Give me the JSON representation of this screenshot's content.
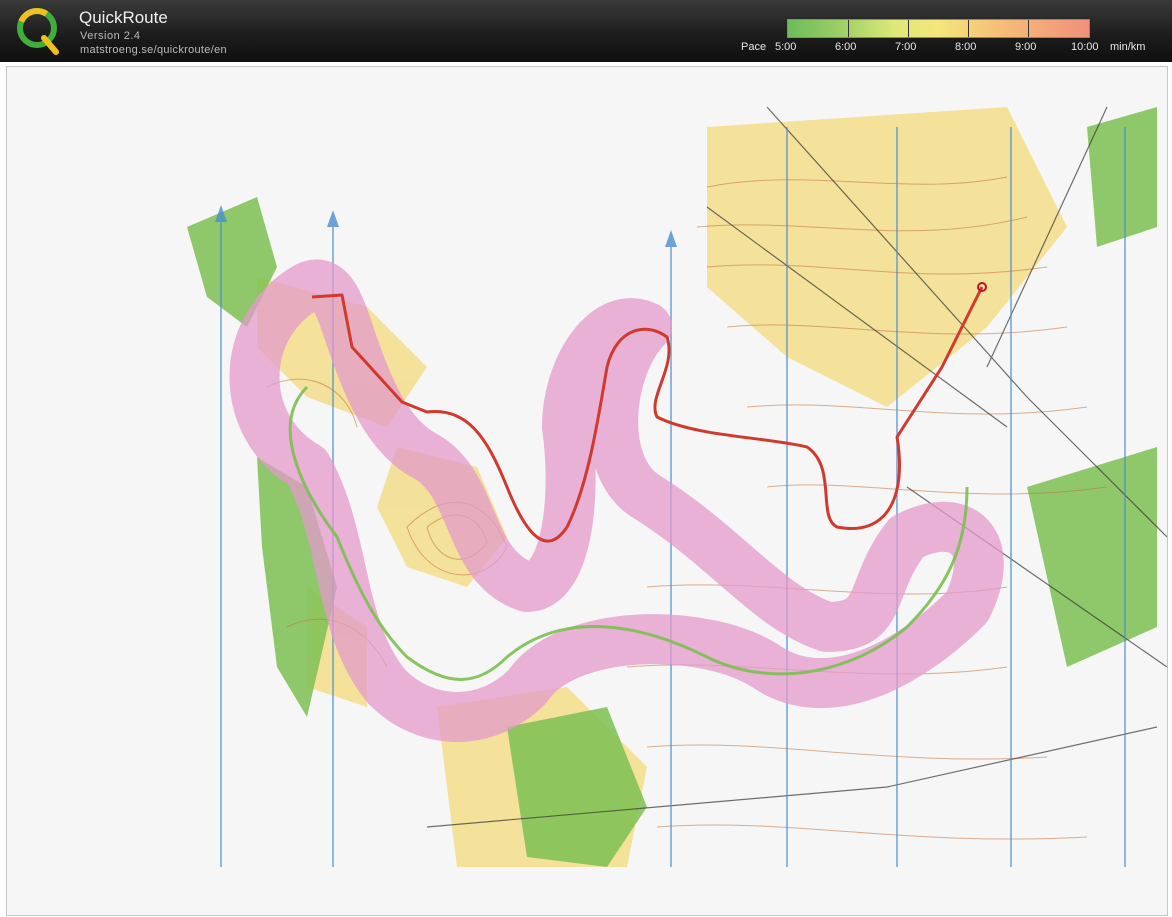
{
  "header": {
    "title": "QuickRoute",
    "version": "Version 2.4",
    "url": "matstroeng.se/quickroute/en"
  },
  "pace_legend": {
    "label": "Pace",
    "ticks": [
      "5:00",
      "6:00",
      "7:00",
      "8:00",
      "9:00",
      "10:00"
    ],
    "unit": "min/km",
    "colors": {
      "fast": "#6dbb5a",
      "medium": "#f4e67b",
      "slow": "#f1907a"
    }
  },
  "map": {
    "colors": {
      "paper": "#f5f5f5",
      "open_land": "#f3dd8a",
      "forest_green": "#7cbf52",
      "contour": "#c0703a",
      "north_lines": "#4a8ed0",
      "corridor": "#e39ac9",
      "route": "#d03a2e"
    }
  }
}
